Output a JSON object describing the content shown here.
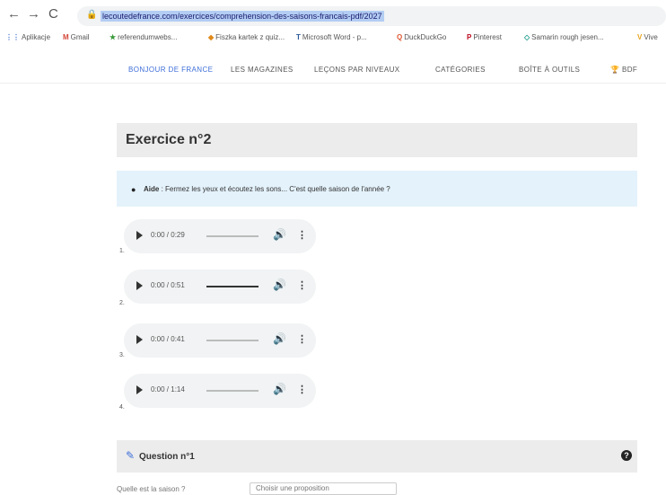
{
  "browser": {
    "url": "lecoutedefrance.com/exercices/comprehension-des-saisons-francais-pdf/2027",
    "nav": {
      "back": "←",
      "forward": "→",
      "reload": "C"
    },
    "bookmarks": [
      {
        "icon": "⋮⋮",
        "label": "Aplikacje"
      },
      {
        "icon": "M",
        "label": "Gmail"
      },
      {
        "icon": "★",
        "label": "referendumwebs..."
      },
      {
        "icon": "◆",
        "label": "Fiszka kartek z quiz..."
      },
      {
        "icon": "T",
        "label": "Microsoft Word - p..."
      },
      {
        "icon": "Q",
        "label": "DuckDuckGo"
      },
      {
        "icon": "P",
        "label": "Pinterest"
      },
      {
        "icon": "◇",
        "label": "Samarin rough jesen..."
      },
      {
        "icon": "V",
        "label": "Vive"
      }
    ]
  },
  "site_nav": {
    "items": [
      "BONJOUR DE FRANCE",
      "LES MAGAZINES",
      "LEÇONS PAR NIVEAUX",
      "CATÉGORIES",
      "BOÎTE À OUTILS",
      "BDF"
    ]
  },
  "exercise": {
    "title": "Exercice n°2",
    "help_label": "Aide",
    "help_text": " : Fermez les yeux et écoutez les sons... C'est quelle saison de l'année ?",
    "players": [
      {
        "number": "1.",
        "time": "0:00 / 0:29",
        "progress": 0
      },
      {
        "number": "2.",
        "time": "0:00 / 0:51",
        "progress": 0
      },
      {
        "number": "3.",
        "time": "0:00 / 0:41",
        "progress": 0
      },
      {
        "number": "4.",
        "time": "0:00 / 1:14",
        "progress": 0
      }
    ]
  },
  "question": {
    "title": "Question n°1",
    "help_icon": "?",
    "prompt": "Quelle est la saison ?",
    "select_value": "Choisir une proposition"
  },
  "colors": {
    "accent": "#3f6fd8",
    "header_bg": "#ececec",
    "help_bg": "#e4f2fb"
  }
}
